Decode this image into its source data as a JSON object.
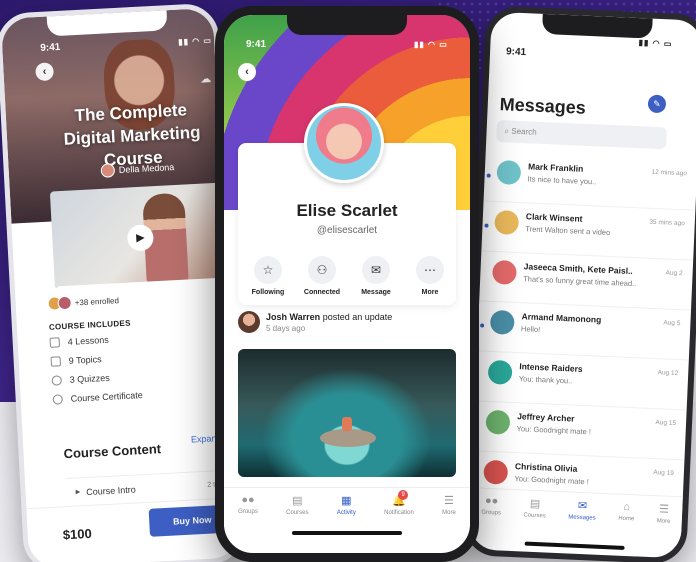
{
  "left_phone": {
    "status_time": "9:41",
    "course_title": "The Complete Digital Marketing Course",
    "author": "Della Medona",
    "enrolled": "+38 enrolled",
    "course_includes_heading": "COURSE INCLUDES",
    "includes": [
      "4 Lessons",
      "9 Topics",
      "3 Quizzes",
      "Course Certificate"
    ],
    "course_content_heading": "Course Content",
    "expand_label": "Expand A",
    "intro_item": "Course Intro",
    "intro_topics": "2 topics",
    "price": "$100",
    "buy_label": "Buy Now"
  },
  "center_phone": {
    "status_time": "9:41",
    "profile_name": "Elise Scarlet",
    "profile_handle": "@elisescarlet",
    "actions": [
      {
        "label": "Following",
        "icon": "following-icon"
      },
      {
        "label": "Connected",
        "icon": "connected-icon"
      },
      {
        "label": "Message",
        "icon": "message-icon"
      },
      {
        "label": "More",
        "icon": "more-icon"
      }
    ],
    "post": {
      "author": "Josh Warren",
      "action": "posted an update",
      "time": "5 days ago"
    },
    "tabs": [
      {
        "label": "Groups",
        "icon": "groups-icon"
      },
      {
        "label": "Courses",
        "icon": "courses-icon"
      },
      {
        "label": "Activity",
        "icon": "activity-icon"
      },
      {
        "label": "Notification",
        "icon": "bell-icon",
        "badge": "9"
      },
      {
        "label": "More",
        "icon": "more-icon"
      }
    ],
    "active_tab": "Activity"
  },
  "right_phone": {
    "status_time": "9:41",
    "title": "Messages",
    "search_placeholder": "Search",
    "messages": [
      {
        "name": "Mark Franklin",
        "text": "Its nice to have you..",
        "time": "12 mins ago",
        "unread": true,
        "avatar_color": "#6fc3c9"
      },
      {
        "name": "Clark Winsent",
        "text": "Trent Walton sent a video",
        "time": "35 mins ago",
        "unread": true,
        "avatar_color": "#e8b85a"
      },
      {
        "name": "Jaseeca Smith, Kete Paisl..",
        "text": "That's so funny great time ahead..",
        "time": "Aug 2",
        "unread": false,
        "avatar_color": "#e46a6a"
      },
      {
        "name": "Armand Mamonong",
        "text": "Hello!",
        "time": "Aug 5",
        "unread": true,
        "avatar_color": "#4a8fa8"
      },
      {
        "name": "Intense Raiders",
        "text": "You: thank you..",
        "time": "Aug 12",
        "unread": false,
        "avatar_color": "#2aa89a"
      },
      {
        "name": "Jeffrey Archer",
        "text": "You: Goodnight mate !",
        "time": "Aug 15",
        "unread": false,
        "avatar_color": "#6db36d"
      },
      {
        "name": "Christina Olivia",
        "text": "You: Goodnight mate !",
        "time": "Aug 19",
        "unread": false,
        "avatar_color": "#d9534f"
      }
    ],
    "tabs": [
      {
        "label": "Groups",
        "icon": "groups-icon"
      },
      {
        "label": "Courses",
        "icon": "courses-icon"
      },
      {
        "label": "Messages",
        "icon": "mail-icon"
      },
      {
        "label": "Home",
        "icon": "home-icon"
      },
      {
        "label": "More",
        "icon": "more-icon"
      }
    ],
    "active_tab": "Messages"
  }
}
